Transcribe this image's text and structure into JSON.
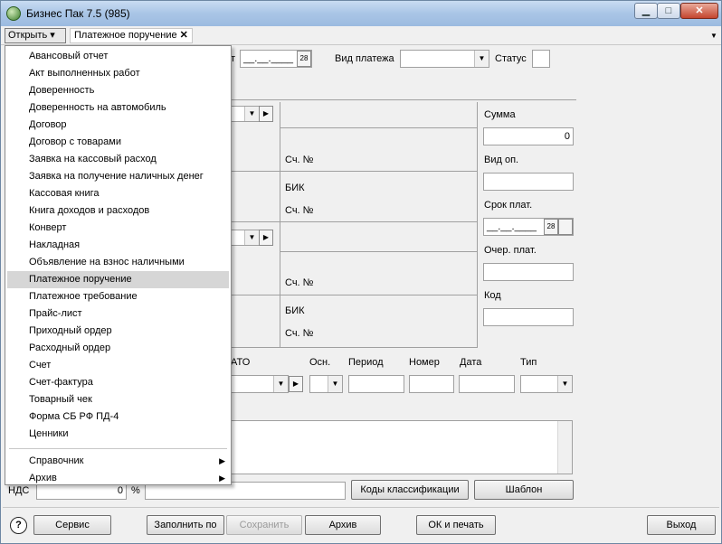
{
  "window": {
    "title": "Бизнес Пак 7.5 (985)",
    "minimize": "▁",
    "maximize": "□",
    "close": "✕"
  },
  "tabbar": {
    "open_label": "Открыть",
    "open_arrow": "▾",
    "doc_tab_label": "Платежное поручение",
    "doc_tab_close": "✕",
    "dropdown_arrow": "▼"
  },
  "header": {
    "date_label_fragment": "т",
    "date_value": "__.__.____",
    "calendar_day": "28",
    "payment_type_label": "Вид платежа",
    "status_label": "Статус"
  },
  "form": {
    "acct1_label": "Сч. №",
    "bik1_label": "БИК",
    "acct2_label": "Сч. №",
    "acct3_label": "Сч. №",
    "bik2_label": "БИК",
    "acct4_label": "Сч. №",
    "sum_label": "Сумма",
    "sum_value": "0",
    "op_type_label": "Вид оп.",
    "due_label": "Срок плат.",
    "due_value": "__.__.____",
    "due_calendar_day": "28",
    "priority_label": "Очер. плат.",
    "code_label": "Код",
    "okato_fragment": "АТО",
    "basis_label": "Осн.",
    "period_label": "Период",
    "number_label": "Номер",
    "date_col_label": "Дата",
    "type_label": "Тип",
    "vat_label": "НДС",
    "vat_value": "0",
    "vat_percent": "%",
    "class_codes_button": "Коды классификации",
    "template_button": "Шаблон",
    "combo_arrow": "▼",
    "next_arrow": "▶"
  },
  "bottom": {
    "help": "?",
    "service": "Сервис",
    "fill_by": "Заполнить по",
    "save": "Сохранить",
    "archive": "Архив",
    "ok_print": "ОК и печать",
    "exit": "Выход"
  },
  "menu": {
    "items": [
      "Авансовый отчет",
      "Акт выполненных работ",
      "Доверенность",
      "Доверенность на автомобиль",
      "Договор",
      "Договор с товарами",
      "Заявка на кассовый расход",
      "Заявка на получение наличных денег",
      "Кассовая книга",
      "Книга доходов и расходов",
      "Конверт",
      "Накладная",
      "Объявление на взнос наличными",
      "Платежное поручение",
      "Платежное требование",
      "Прайс-лист",
      "Приходный ордер",
      "Расходный ордер",
      "Счет",
      "Счет-фактура",
      "Товарный чек",
      "Форма СБ РФ ПД-4",
      "Ценники"
    ],
    "selected": "Платежное поручение",
    "submenus": [
      "Справочник",
      "Архив"
    ],
    "submenu_arrow": "▶"
  }
}
